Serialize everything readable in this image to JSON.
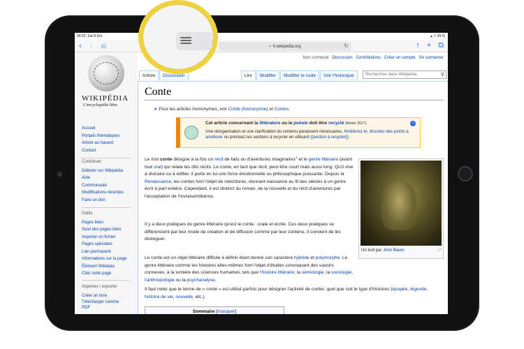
{
  "status": {
    "time": "00:23",
    "date": "Sat 8 Oct",
    "right": "▴ ↗ 29 %"
  },
  "browser": {
    "back": "‹",
    "forward": "›",
    "bookmarks": "▯▯",
    "url": "fr.wikipedia.org",
    "lock": "▪",
    "reload": "↻",
    "share": "↑",
    "new_tab": "+",
    "tabs": "⧉"
  },
  "logo": {
    "title": "WIKIPÉDIA",
    "subtitle": "L'encyclopédie libre"
  },
  "sidebar": {
    "main": [
      "Accueil",
      "Portails thématiques",
      "Article au hasard",
      "Contact"
    ],
    "contribute_head": "Contribuer",
    "contribute": [
      "Débuter sur Wikipédia",
      "Aide",
      "Communauté",
      "Modifications récentes",
      "Faire un don"
    ],
    "tools_head": "Outils",
    "tools": [
      "Pages liées",
      "Suivi des pages liées",
      "Importer un fichier",
      "Pages spéciales",
      "Lien permanent",
      "Informations sur la page",
      "Élément Wikidata",
      "Citer cette page"
    ],
    "print_head": "Imprimer / exporter",
    "print": [
      "Créer un livre",
      "Télécharger comme PDF"
    ]
  },
  "personal": {
    "not_logged": "Non connecté",
    "discussion": "Discussion",
    "contributions": "Contributions",
    "create": "Créer un compte",
    "login": "Se connecter"
  },
  "tabs": {
    "article": "Article",
    "discussion": "Discussion",
    "read": "Lire",
    "edit": "Modifier",
    "edit_code": "Modifier le code",
    "history": "Voir l'historique"
  },
  "search": {
    "placeholder": "Rechercher dans Wikipédia"
  },
  "article": {
    "title": "Conte",
    "hatnote_pre": "Pour les articles homonymes, voir ",
    "hatnote_link1": "Conte (homonymie)",
    "hatnote_mid": " et ",
    "hatnote_link2": "Contes",
    "hatnote_end": ".",
    "bandeau_title_pre": "Cet article concernant la ",
    "bandeau_title_l1": "littérature",
    "bandeau_title_mid": " ou la ",
    "bandeau_title_l2": "poésie",
    "bandeau_title_mid2": " doit être ",
    "bandeau_title_l3": "recyclé",
    "bandeau_date": "(février 2017).",
    "bandeau_text_pre": "Une réorganisation et une clarification du contenu paraissent nécessaires. ",
    "bandeau_text_link": "Améliorez-le, discutez des points à améliorer",
    "bandeau_text_mid": " ou précisez les sections à recycler en utilisant ",
    "bandeau_text_link2": "{{section à recycler}}",
    "bandeau_text_end": ".",
    "p1": [
      "Le mot ",
      "conte",
      " désigne à la fois un ",
      "récit",
      " de faits ou d'aventures imaginaires",
      "1",
      " et le ",
      "genre littéraire",
      " (avant tout ",
      "oral",
      ") qui relate les dits récits. Le conte, en tant que récit, peut être court mais aussi long. Qu'il vise à distraire ou à édifier, il porte en lui une force émotionnelle ou philosophique puissante. Depuis la ",
      "Renaissance",
      ", les contes font l'objet de réécritures, donnant naissance au fil des siècles à un genre écrit à part entière. Cependant, il est distinct du roman, de la nouvelle et du récit d'aventures par l'acceptation de l'invraisemblance."
    ],
    "p2": "Il y a deux pratiques du genre littéraire qu'est le conte : orale et écrite. Ces deux pratiques se différencient par leur mode de création et de diffusion comme par leur contenu, il convient de les distinguer.",
    "p3": [
      "Le conte est un objet littéraire difficile à définir étant donné son caractère ",
      "hybride",
      " et ",
      "polymorphe",
      ". Le genre littéraire comme les histoires elles-mêmes font l'objet d'études convoquant des savoirs connexes, à la lumière des sciences humaines, tels que ",
      "l'histoire littéraire",
      ", la ",
      "sémiologie",
      ", la ",
      "sociologie",
      ", ",
      "l'anthropologie",
      " ou la ",
      "psychanalyse",
      "."
    ],
    "p4": [
      "Il faut noter que le terme de « conte » est utilisé parfois pour désigner l'activité de conter, quel que soit le type d'histoires (",
      "épopée",
      ", ",
      "légende",
      ", ",
      "histoire de vie",
      ", ",
      "nouvelle",
      ", etc.)."
    ],
    "thumb_caption_pre": "Un troll par ",
    "thumb_caption_link": "John Bauer",
    "thumb_zoom": "⤢",
    "toc_title": "Sommaire",
    "toc_toggle": "masquer"
  }
}
